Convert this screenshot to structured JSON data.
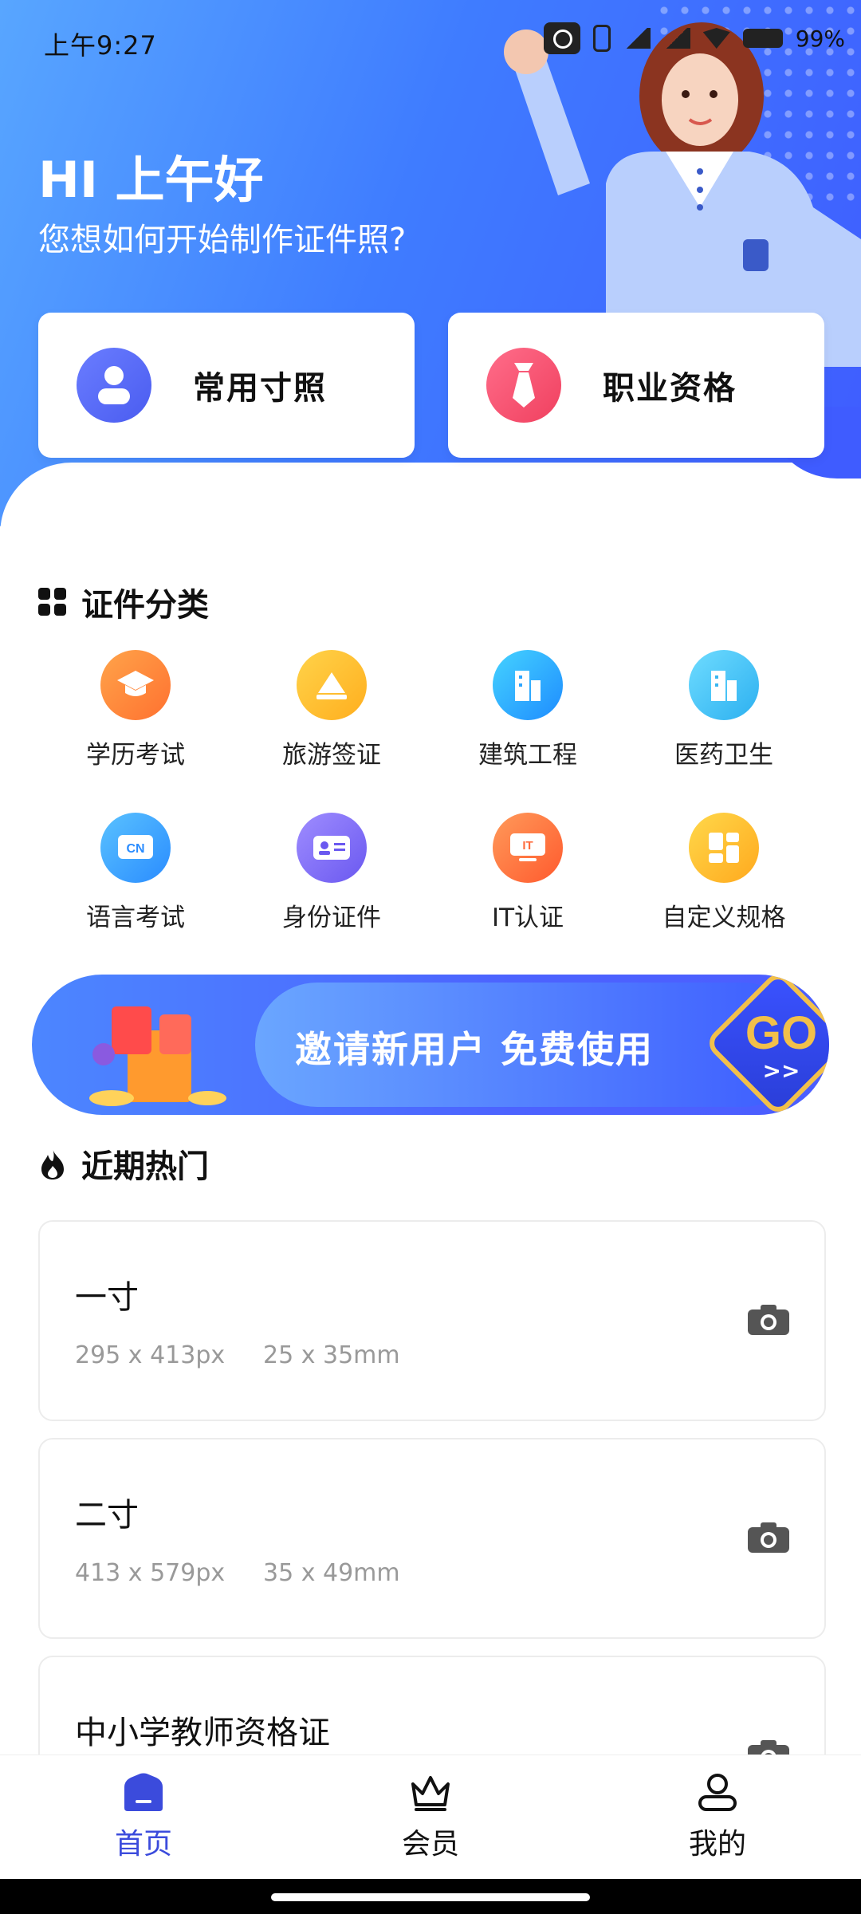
{
  "status": {
    "time": "上午9:27",
    "battery": "99%"
  },
  "hero": {
    "greeting": "HI 上午好",
    "subtitle": "您想如何开始制作证件照?",
    "cards": [
      {
        "label": "常用寸照",
        "icon": "person-icon",
        "color": "#5a6cff"
      },
      {
        "label": "职业资格",
        "icon": "tie-icon",
        "color": "#ff5b7c"
      }
    ]
  },
  "categories_section": {
    "title": "证件分类",
    "items": [
      {
        "label": "学历考试",
        "icon": "graduation-cap-icon",
        "color": "#ff8a3d"
      },
      {
        "label": "旅游签证",
        "icon": "mountain-icon",
        "color": "#ffc23a"
      },
      {
        "label": "建筑工程",
        "icon": "building-icon",
        "color": "#2bb5ff"
      },
      {
        "label": "医药卫生",
        "icon": "hospital-icon",
        "color": "#43c8ff"
      },
      {
        "label": "语言考试",
        "icon": "cn-badge-icon",
        "color": "#3aa9ff"
      },
      {
        "label": "身份证件",
        "icon": "id-card-icon",
        "color": "#7a6bff"
      },
      {
        "label": "IT认证",
        "icon": "it-monitor-icon",
        "color": "#ff6b3d"
      },
      {
        "label": "自定义规格",
        "icon": "grid-layout-icon",
        "color": "#ffbe2e"
      }
    ]
  },
  "banner": {
    "text": "邀请新用户 免费使用",
    "go": "GO",
    "arrow": ">>"
  },
  "recent_section": {
    "title": "近期热门",
    "items": [
      {
        "name": "一寸",
        "px": "295 x 413px",
        "mm": "25 x 35mm"
      },
      {
        "name": "二寸",
        "px": "413 x 579px",
        "mm": "35 x 49mm"
      },
      {
        "name": "中小学教师资格证",
        "px": "",
        "mm": ""
      }
    ]
  },
  "nav": {
    "items": [
      {
        "label": "首页",
        "active": true
      },
      {
        "label": "会员",
        "active": false
      },
      {
        "label": "我的",
        "active": false
      }
    ],
    "active_color": "#3b4bdc"
  }
}
